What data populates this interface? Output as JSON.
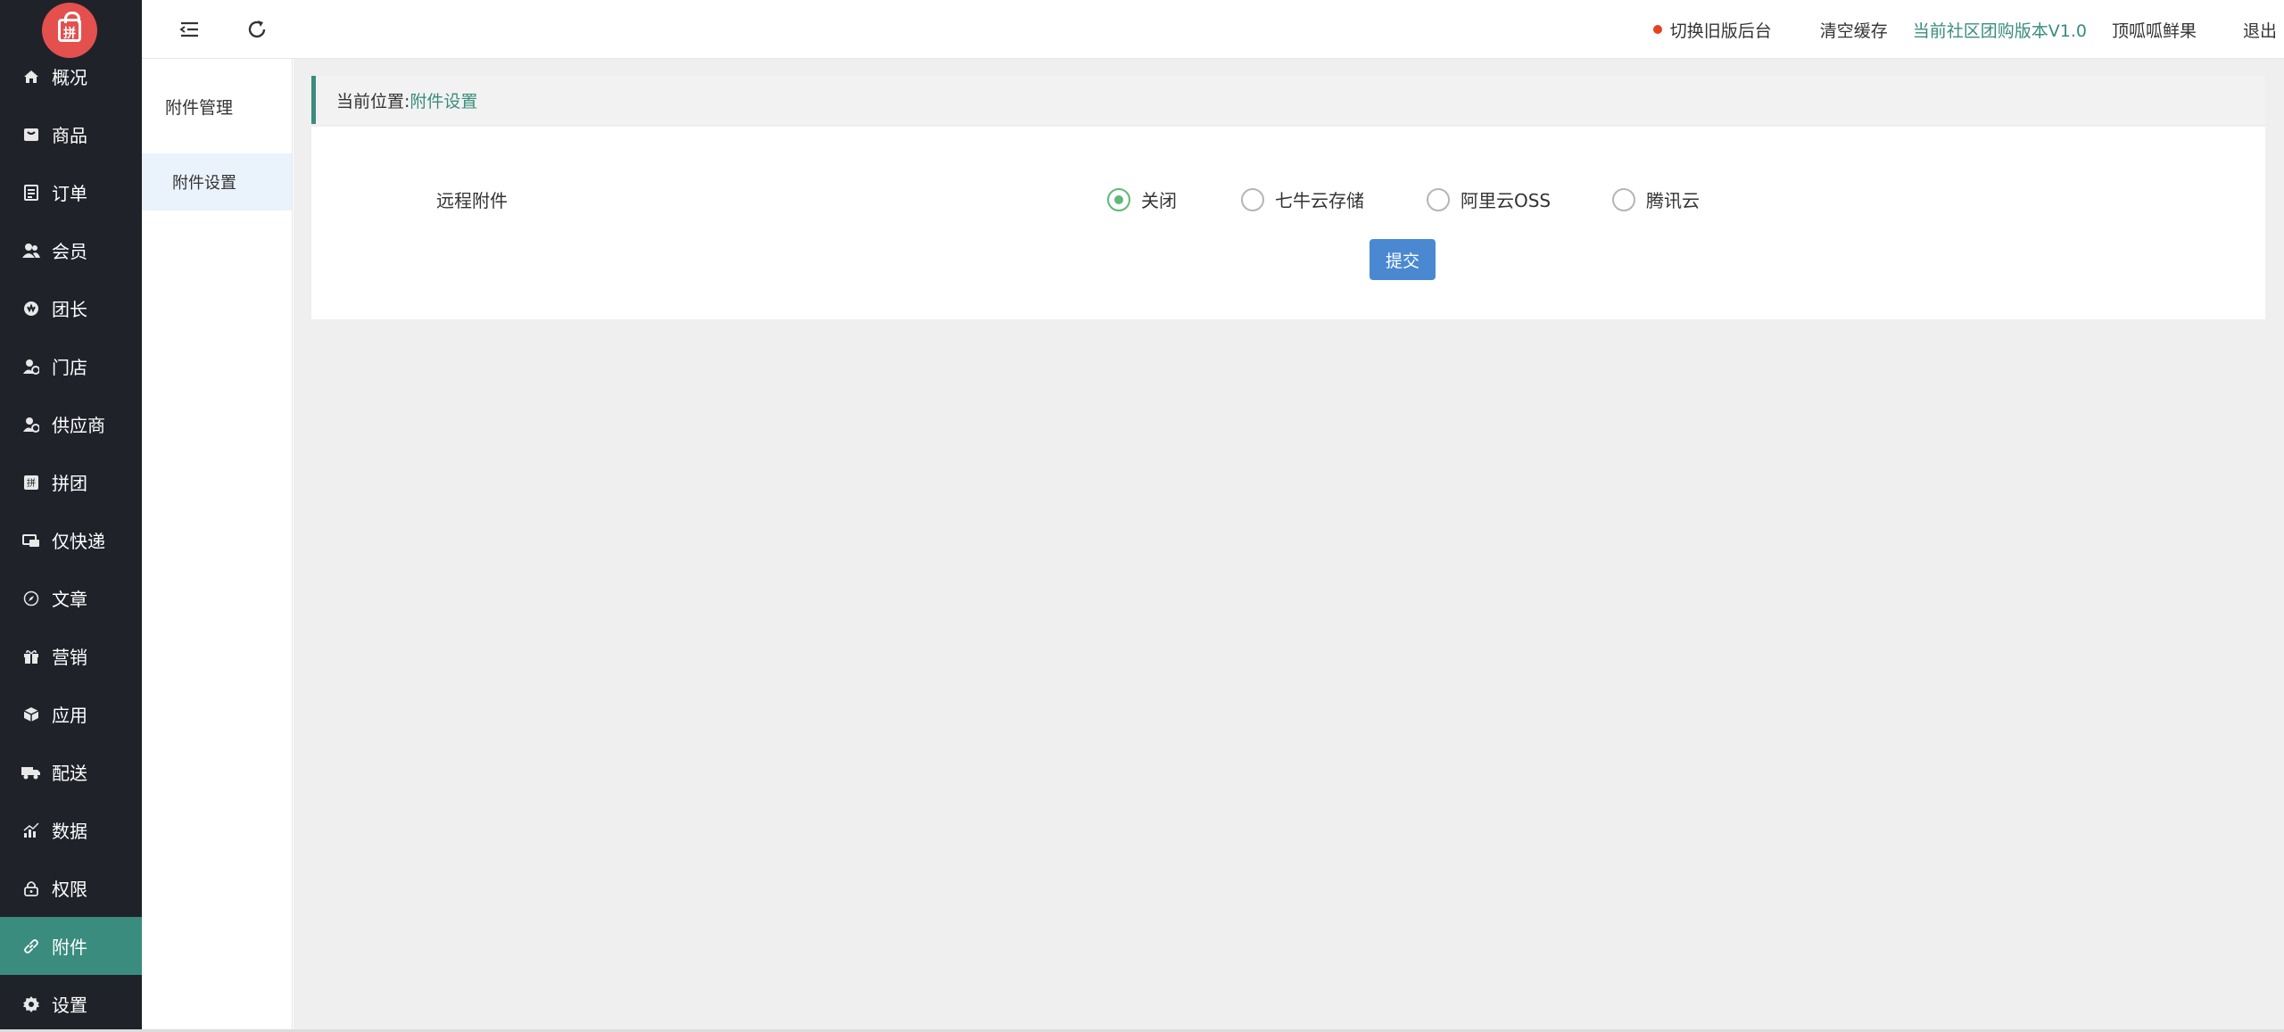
{
  "logo": {
    "char": "拼",
    "icon": "shopping-bag-icon"
  },
  "sidebar": {
    "items": [
      {
        "label": "概况",
        "icon": "home-icon",
        "active": false
      },
      {
        "label": "商品",
        "icon": "goods-icon",
        "active": false
      },
      {
        "label": "订单",
        "icon": "order-icon",
        "active": false
      },
      {
        "label": "会员",
        "icon": "members-icon",
        "active": false
      },
      {
        "label": "团长",
        "icon": "leader-icon",
        "active": false
      },
      {
        "label": "门店",
        "icon": "store-icon",
        "active": false
      },
      {
        "label": "供应商",
        "icon": "supplier-icon",
        "active": false
      },
      {
        "label": "拼团",
        "icon": "group-buy-icon",
        "active": false
      },
      {
        "label": "仅快递",
        "icon": "express-icon",
        "active": false
      },
      {
        "label": "文章",
        "icon": "compass-icon",
        "active": false
      },
      {
        "label": "营销",
        "icon": "gift-icon",
        "active": false
      },
      {
        "label": "应用",
        "icon": "cube-icon",
        "active": false
      },
      {
        "label": "配送",
        "icon": "truck-icon",
        "active": false
      },
      {
        "label": "数据",
        "icon": "chart-icon",
        "active": false
      },
      {
        "label": "权限",
        "icon": "lock-icon",
        "active": false
      },
      {
        "label": "附件",
        "icon": "link-icon",
        "active": true
      },
      {
        "label": "设置",
        "icon": "gear-icon",
        "active": false
      }
    ]
  },
  "header": {
    "switch_label": "切换旧版后台",
    "clear_cache_label": "清空缓存",
    "version_label": "当前社区团购版本V1.0",
    "shop_name": "顶呱呱鲜果",
    "logout_label": "退出",
    "colors": {
      "dot": "#e5421e",
      "version": "#3a8c7e"
    }
  },
  "subnav": {
    "title": "附件管理",
    "items": [
      {
        "label": "附件设置",
        "active": true
      }
    ]
  },
  "breadcrumb": {
    "prefix": "当前位置:",
    "current": "附件设置"
  },
  "form": {
    "label": "远程附件",
    "options": [
      {
        "label": "关闭",
        "checked": true
      },
      {
        "label": "七牛云存储",
        "checked": false
      },
      {
        "label": "阿里云OSS",
        "checked": false
      },
      {
        "label": "腾讯云",
        "checked": false
      }
    ],
    "submit_label": "提交"
  },
  "colors": {
    "sidebar_bg": "#20222a",
    "accent": "#3a8c7e",
    "button": "#4a89d2",
    "radio_checked": "#5fb878"
  }
}
